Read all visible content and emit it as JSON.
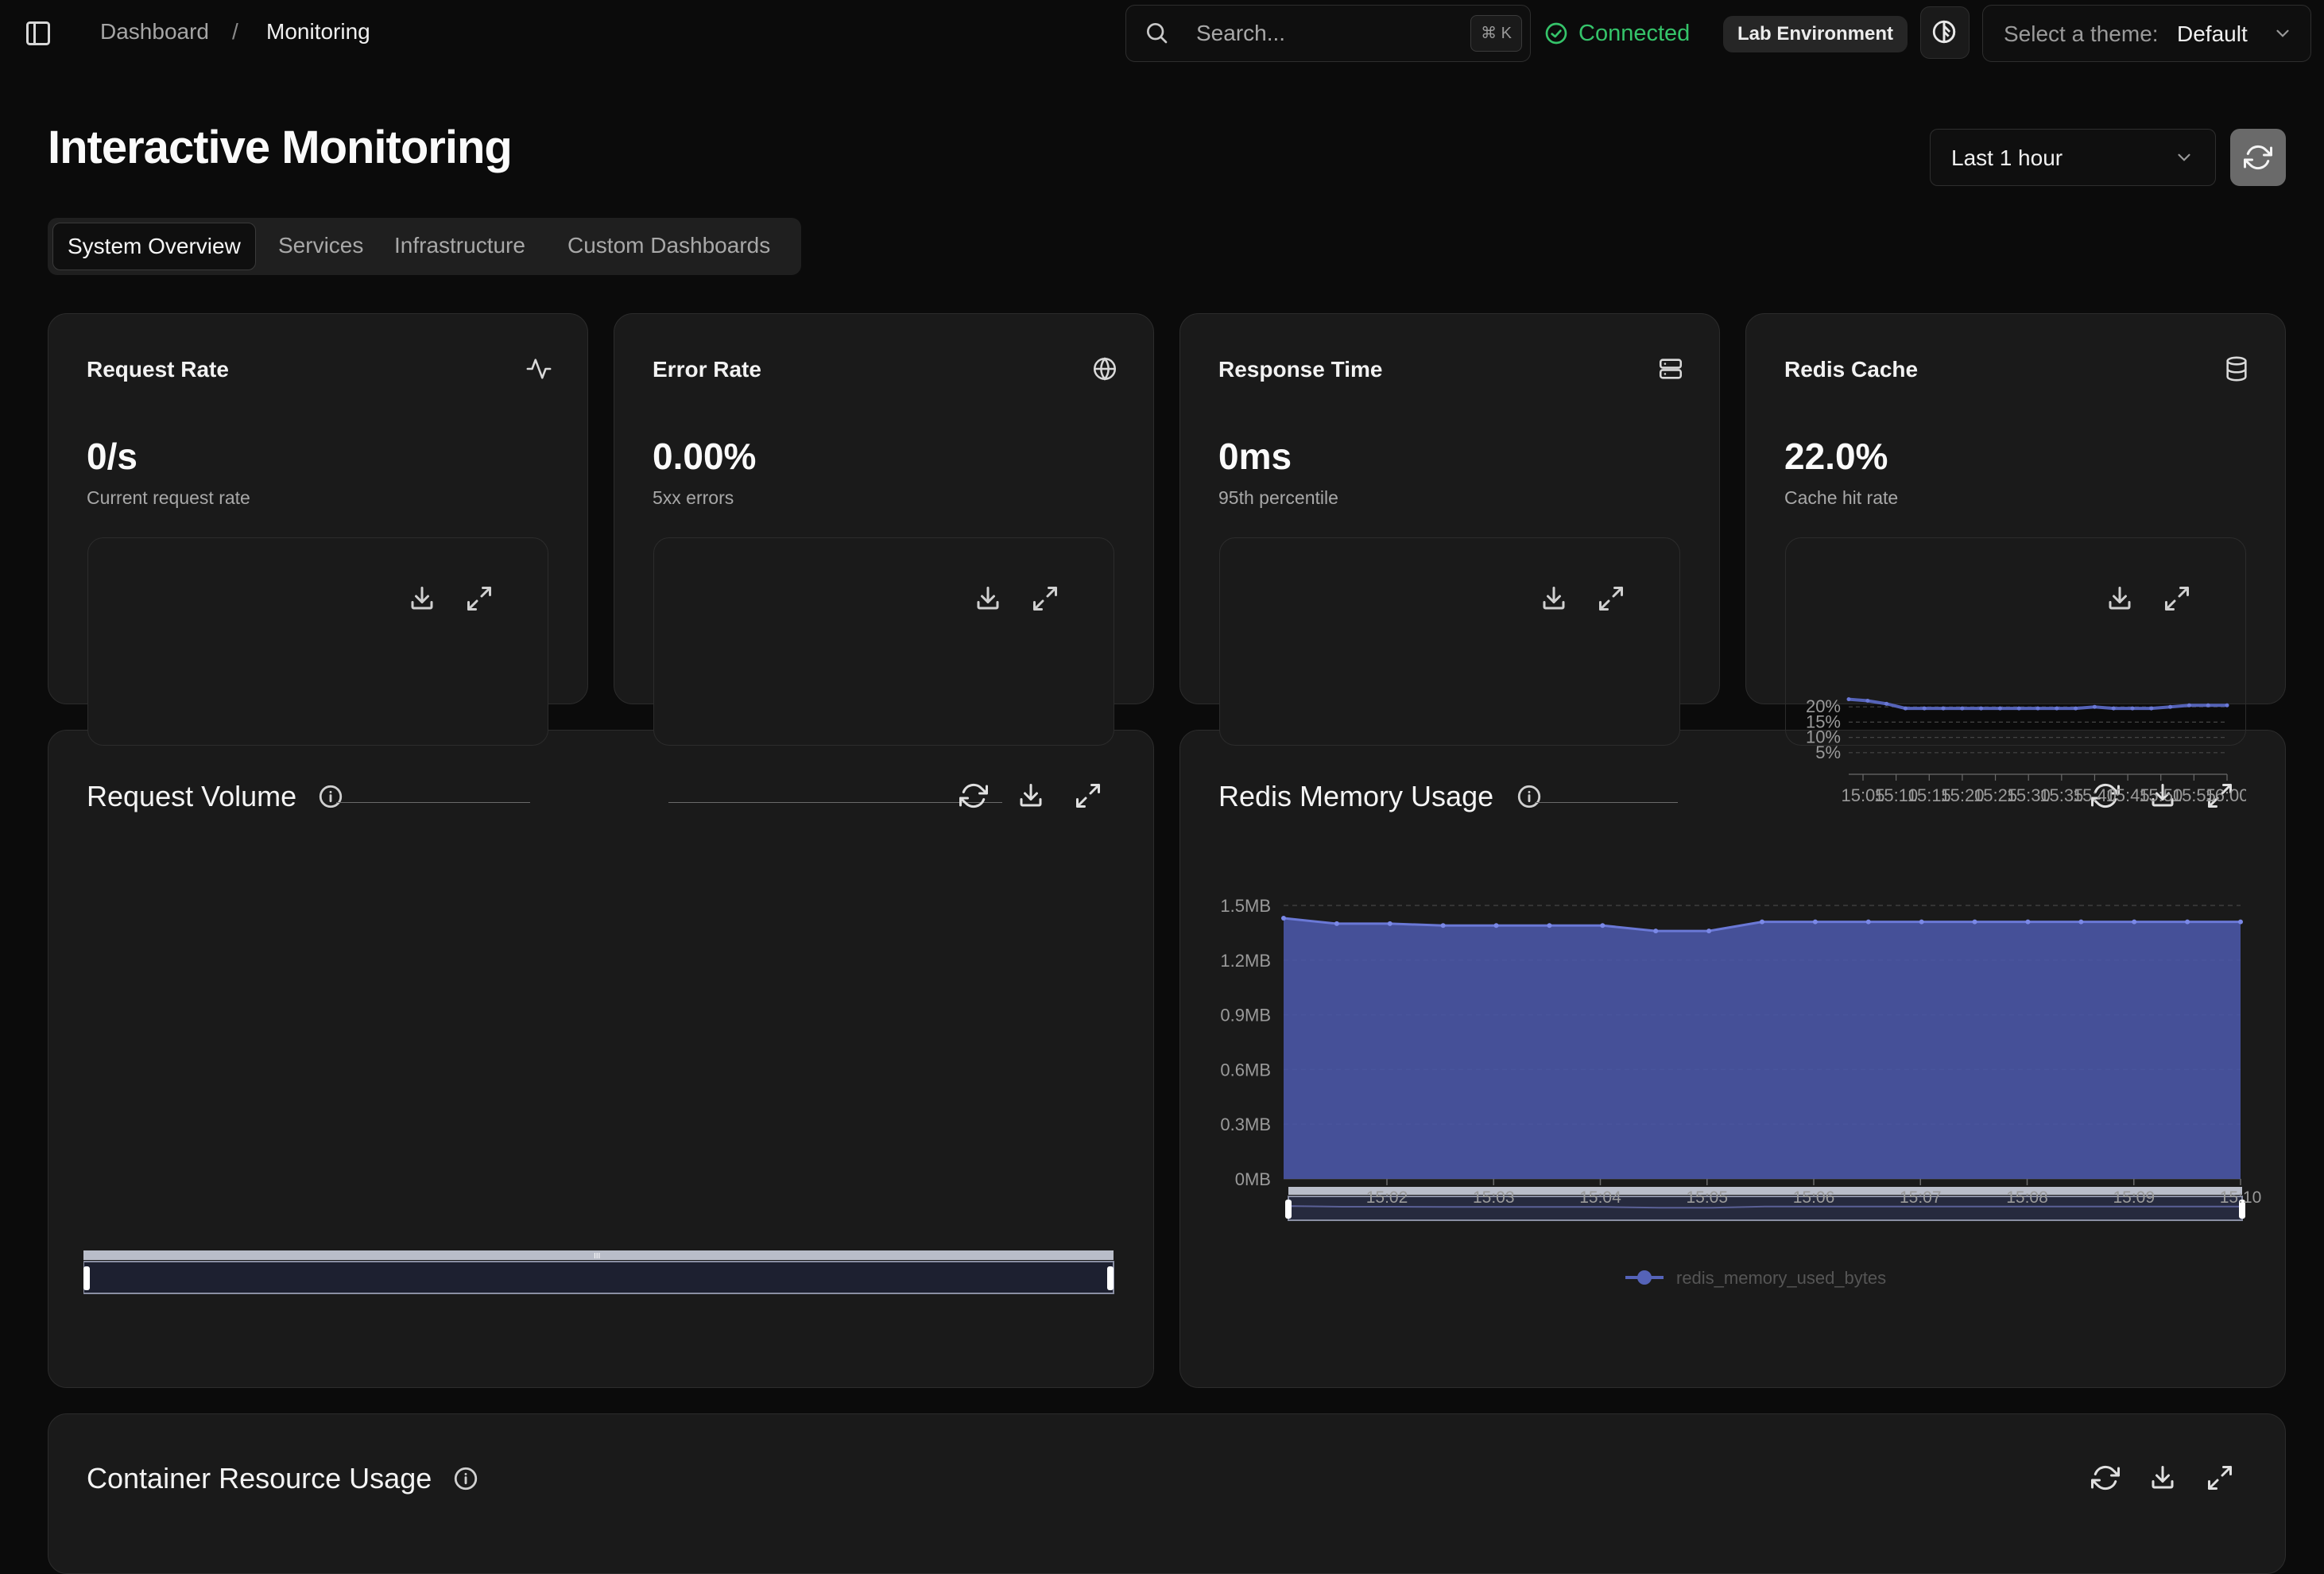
{
  "breadcrumb": {
    "home": "Dashboard",
    "separator": "/",
    "current": "Monitoring"
  },
  "search": {
    "placeholder": "Search...",
    "shortcut": "⌘ K"
  },
  "connection": {
    "status": "Connected",
    "color": "#35c46a"
  },
  "environment": {
    "label": "Lab Environment"
  },
  "theme": {
    "label": "Select a theme:",
    "value": "Default"
  },
  "page": {
    "title": "Interactive Monitoring"
  },
  "time_range": {
    "value": "Last 1 hour"
  },
  "tabs": [
    {
      "label": "System Overview",
      "active": true
    },
    {
      "label": "Services"
    },
    {
      "label": "Infrastructure"
    },
    {
      "label": "Custom Dashboards"
    }
  ],
  "stats": [
    {
      "title": "Request Rate",
      "value": "0/s",
      "subtitle": "Current request rate",
      "icon": "activity-icon"
    },
    {
      "title": "Error Rate",
      "value": "0.00%",
      "subtitle": "5xx errors",
      "icon": "globe-icon"
    },
    {
      "title": "Response Time",
      "value": "0ms",
      "subtitle": "95th percentile",
      "icon": "server-icon"
    },
    {
      "title": "Redis Cache",
      "value": "22.0%",
      "subtitle": "Cache hit rate",
      "icon": "database-icon"
    }
  ],
  "panels": {
    "request_volume": {
      "title": "Request Volume"
    },
    "redis_memory": {
      "title": "Redis Memory Usage"
    },
    "container_resources": {
      "title": "Container Resource Usage"
    }
  },
  "accent_color": "#5563b8",
  "chart_data": [
    {
      "id": "redis-memory-usage",
      "type": "area",
      "title": "Redis Memory Usage",
      "ylim": [
        0,
        1.5
      ],
      "y_ticks": [
        "0MB",
        "0.3MB",
        "0.6MB",
        "0.9MB",
        "1.2MB",
        "1.5MB"
      ],
      "x_ticks": [
        "15:02",
        "15:03",
        "15:04",
        "15:05",
        "15:06",
        "15:07",
        "15:08",
        "15:09",
        "15:10"
      ],
      "grid": true,
      "legend": "bottom",
      "series": [
        {
          "name": "redis_memory_used_bytes",
          "points": [
            1.43,
            1.4,
            1.4,
            1.39,
            1.39,
            1.39,
            1.39,
            1.36,
            1.36,
            1.41,
            1.41,
            1.41,
            1.41,
            1.41,
            1.41,
            1.41,
            1.41,
            1.41,
            1.41
          ]
        }
      ]
    },
    {
      "id": "redis-cache-hit-rate",
      "type": "line",
      "y_ticks": [
        "5%",
        "10%",
        "15%",
        "20%"
      ],
      "ylim": [
        0,
        25
      ],
      "x_ticks": [
        "15:05",
        "15:10",
        "15:15",
        "15:20",
        "15:25",
        "15:30",
        "15:35",
        "15:40",
        "15:45",
        "15:50",
        "15:55",
        "16:00"
      ],
      "grid": true,
      "series": [
        {
          "points": [
            22.5,
            22,
            21,
            19.5,
            19.5,
            19.5,
            19.5,
            19.5,
            19.5,
            19.5,
            19.5,
            19.5,
            19.5,
            20,
            19.5,
            19.5,
            19.5,
            20,
            20.5,
            20.5,
            20.5
          ]
        }
      ]
    }
  ]
}
